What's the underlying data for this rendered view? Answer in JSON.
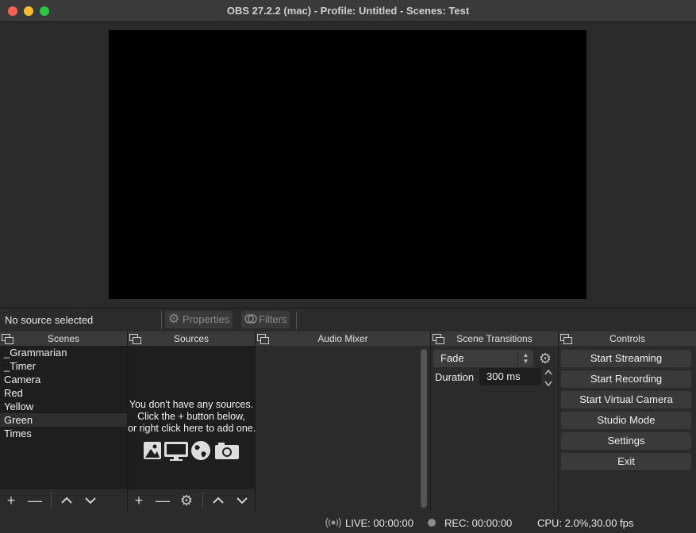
{
  "window": {
    "title": "OBS 27.2.2 (mac) - Profile: Untitled - Scenes: Test"
  },
  "source_toolbar": {
    "status": "No source selected",
    "properties_label": "Properties",
    "filters_label": "Filters"
  },
  "scenes": {
    "title": "Scenes",
    "items": [
      {
        "label": "_Grammarian",
        "selected": false
      },
      {
        "label": "_Timer",
        "selected": false
      },
      {
        "label": "Camera",
        "selected": false
      },
      {
        "label": "Red",
        "selected": false
      },
      {
        "label": "Yellow",
        "selected": false
      },
      {
        "label": "Green",
        "selected": true
      },
      {
        "label": "Times",
        "selected": false
      }
    ]
  },
  "sources": {
    "title": "Sources",
    "empty_line1": "You don't have any sources.",
    "empty_line2": "Click the + button below,",
    "empty_line3": "or right click here to add one."
  },
  "mixer": {
    "title": "Audio Mixer"
  },
  "transitions": {
    "title": "Scene Transitions",
    "selected": "Fade",
    "duration_label": "Duration",
    "duration_value": "300 ms"
  },
  "controls": {
    "title": "Controls",
    "buttons": [
      "Start Streaming",
      "Start Recording",
      "Start Virtual Camera",
      "Studio Mode",
      "Settings",
      "Exit"
    ]
  },
  "status": {
    "live": "LIVE: 00:00:00",
    "rec": "REC: 00:00:00",
    "cpu": "CPU: 2.0%,30.00 fps"
  },
  "icons": {
    "add": "+",
    "remove": "—",
    "up": "⌃",
    "down": "⌄",
    "gear": "⚙"
  }
}
